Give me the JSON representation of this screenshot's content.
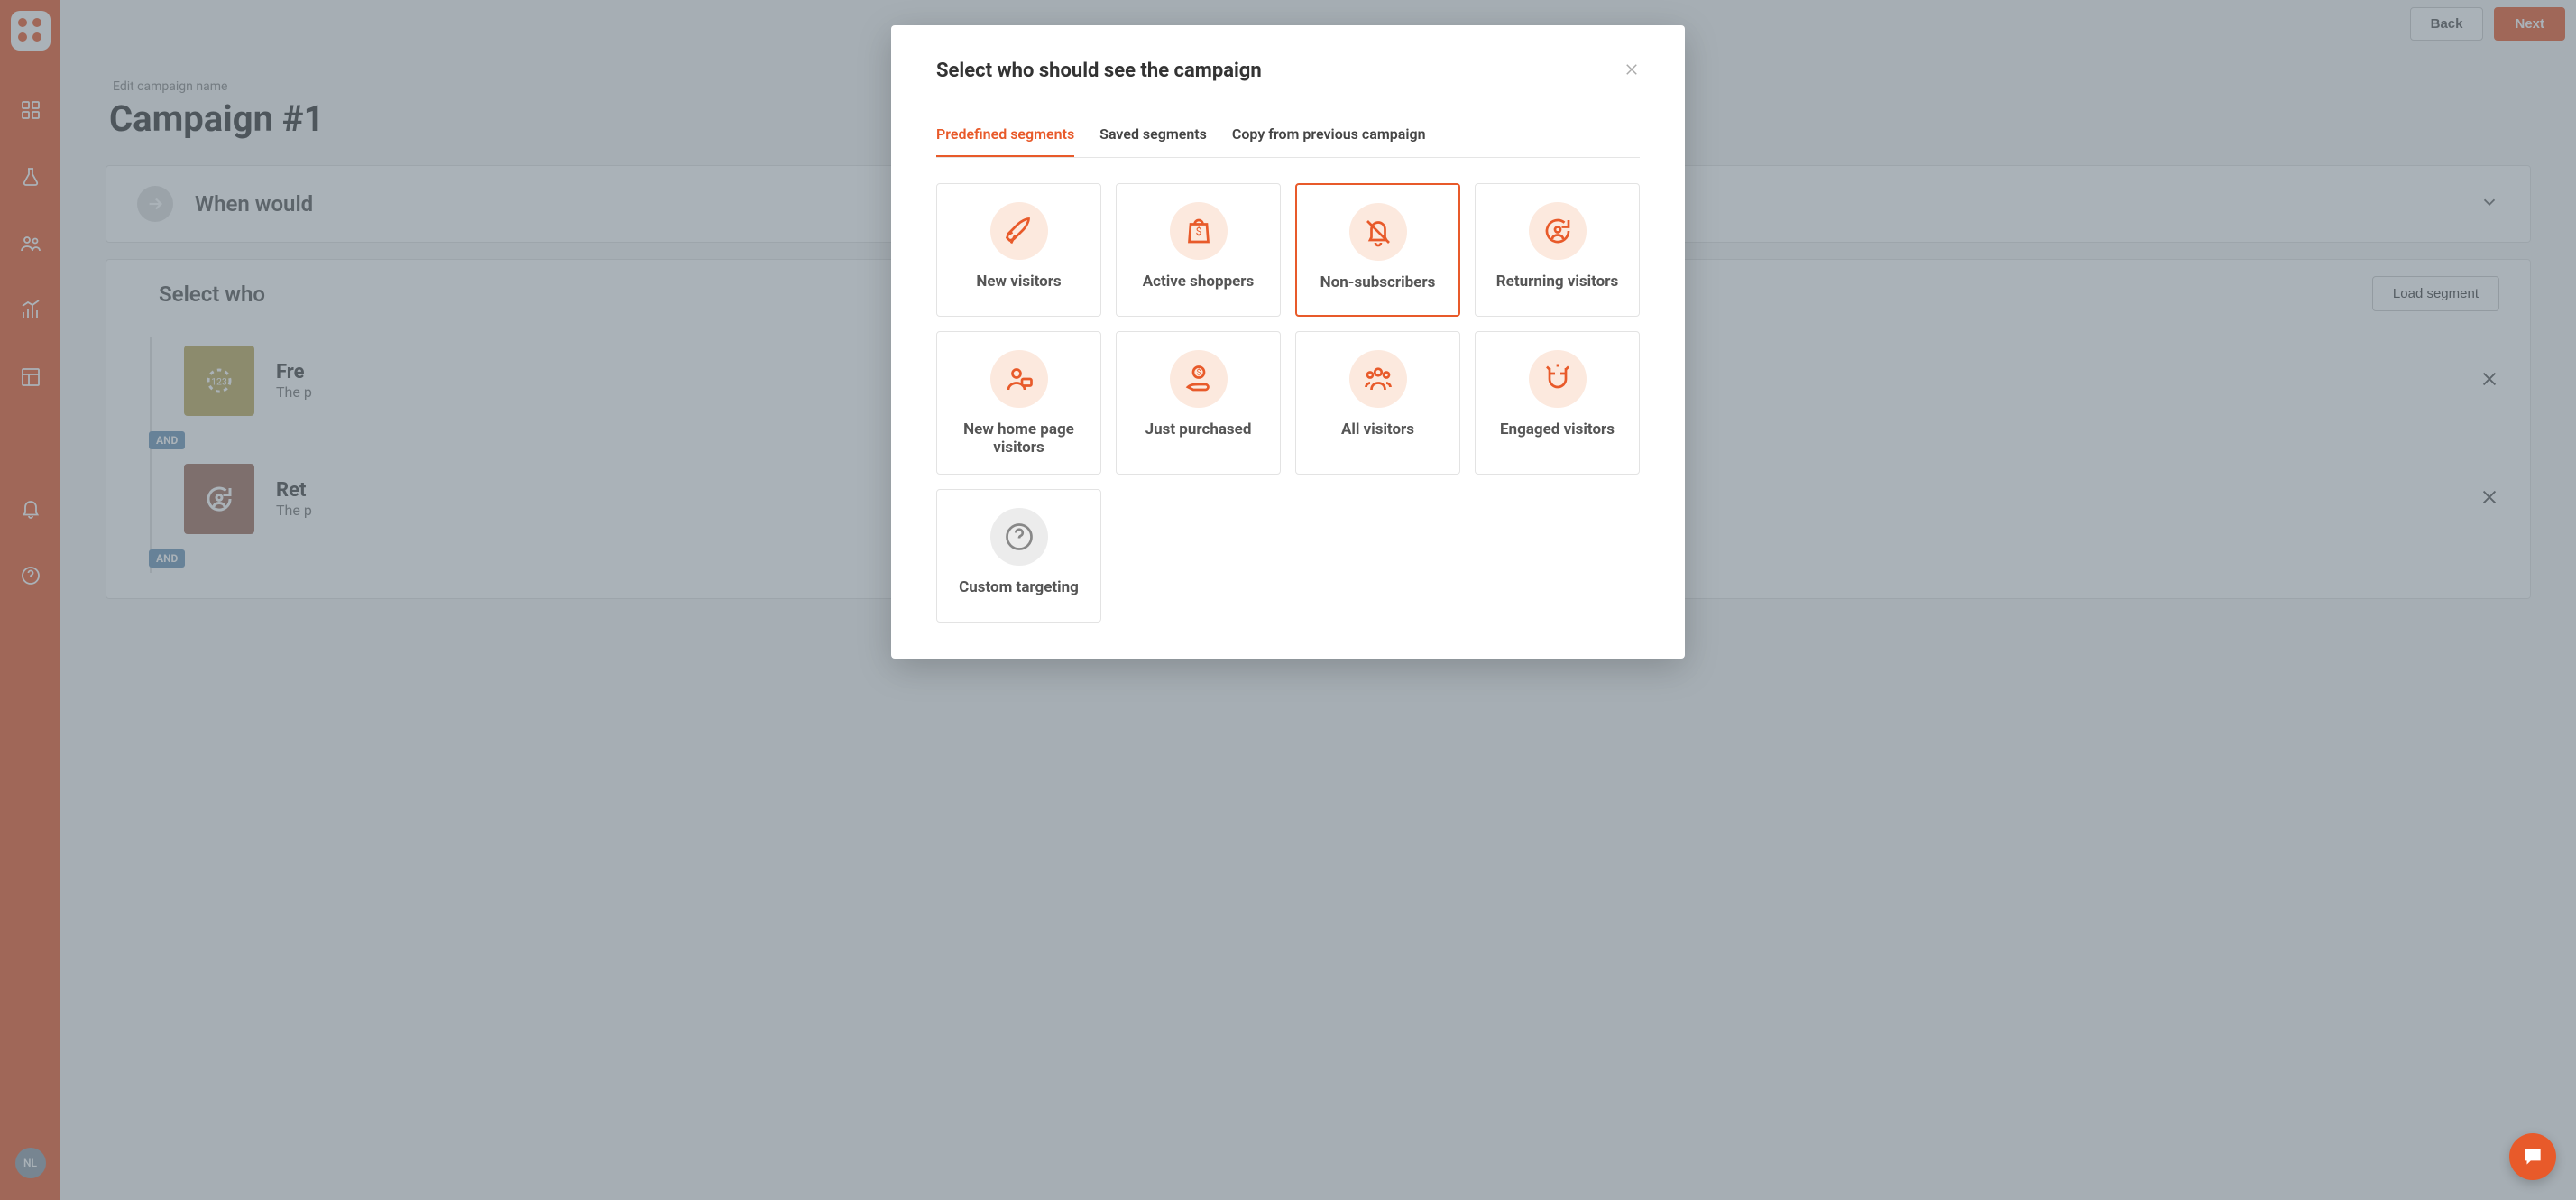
{
  "topbar": {
    "back_label": "Back",
    "next_label": "Next"
  },
  "page": {
    "edit_name_label": "Edit campaign name",
    "campaign_title": "Campaign #1",
    "panel_when_title": "When would",
    "panel_who_title": "Select who",
    "load_segment_label": "Load segment",
    "seg1_title": "Fre",
    "seg1_sub": "The p",
    "seg2_title": "Ret",
    "seg2_sub": "The p",
    "and_label": "AND"
  },
  "sidebar": {
    "avatar_initials": "NL"
  },
  "modal": {
    "title": "Select who should see the campaign",
    "tabs": {
      "predefined": "Predefined segments",
      "saved": "Saved segments",
      "copy": "Copy from previous campaign"
    },
    "cards": {
      "new_visitors": "New visitors",
      "active_shoppers": "Active shoppers",
      "non_subscribers": "Non-subscribers",
      "returning_visitors": "Returning visitors",
      "new_home_page": "New home page visitors",
      "just_purchased": "Just purchased",
      "all_visitors": "All visitors",
      "engaged_visitors": "Engaged visitors",
      "custom_targeting": "Custom targeting"
    }
  }
}
